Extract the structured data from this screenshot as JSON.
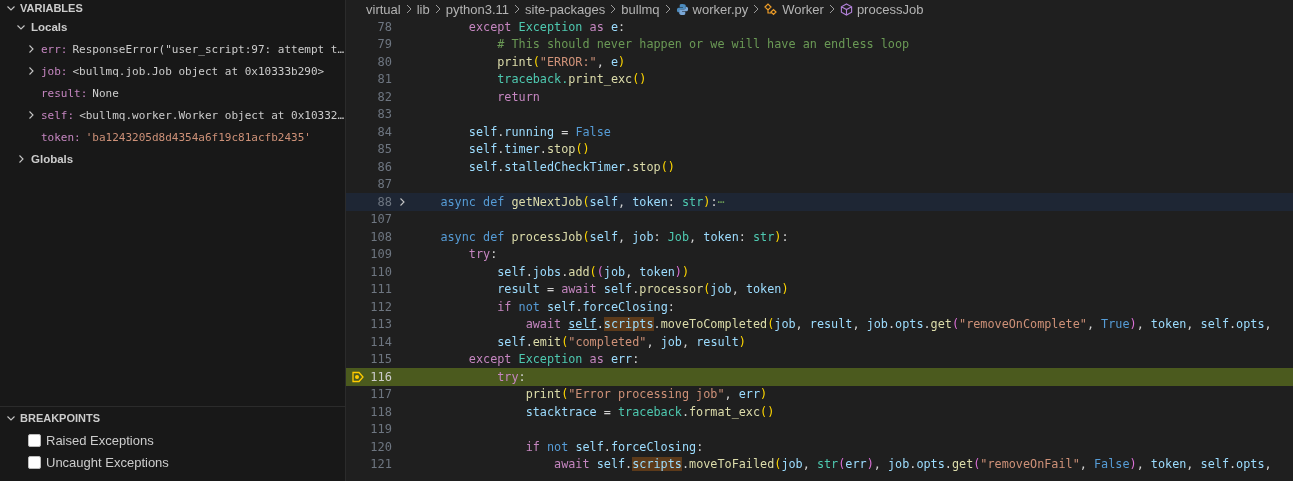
{
  "variables": {
    "title": "VARIABLES",
    "expanded": true,
    "scopes": [
      {
        "label": "Locals",
        "expanded": true,
        "items": [
          {
            "name": "err:",
            "value": "ResponseError(\"user_script:97: attempt t…",
            "kind": "object",
            "expandable": true
          },
          {
            "name": "job:",
            "value": "<bullmq.job.Job object at 0x10333b290>",
            "kind": "object",
            "expandable": true
          },
          {
            "name": "result:",
            "value": "None",
            "kind": "none",
            "expandable": false
          },
          {
            "name": "self:",
            "value": "<bullmq.worker.Worker object at 0x10332…",
            "kind": "object",
            "expandable": true
          },
          {
            "name": "token:",
            "value": "'ba1243205d8d4354a6f19c81acfb2435'",
            "kind": "string",
            "expandable": false
          }
        ]
      },
      {
        "label": "Globals",
        "expanded": false
      }
    ]
  },
  "breakpoints": {
    "title": "BREAKPOINTS",
    "expanded": true,
    "items": [
      {
        "label": "Raised Exceptions",
        "checked": false
      },
      {
        "label": "Uncaught Exceptions",
        "checked": false
      }
    ]
  },
  "breadcrumb": [
    {
      "label": "virtual",
      "kind": "folder"
    },
    {
      "label": "lib",
      "kind": "folder"
    },
    {
      "label": "python3.11",
      "kind": "folder"
    },
    {
      "label": "site-packages",
      "kind": "folder"
    },
    {
      "label": "bullmq",
      "kind": "folder"
    },
    {
      "label": "worker.py",
      "kind": "file"
    },
    {
      "label": "Worker",
      "kind": "class"
    },
    {
      "label": "processJob",
      "kind": "method"
    }
  ],
  "lines": [
    {
      "number": "78",
      "current": false,
      "folded": false,
      "tokens": [
        {
          "text": "        except ",
          "kind": "kw"
        },
        {
          "text": "Exception ",
          "kind": "cls"
        },
        {
          "text": "as ",
          "kind": "kw"
        },
        {
          "text": "e",
          "kind": "var"
        },
        {
          "text": ":",
          "kind": "p"
        }
      ]
    },
    {
      "number": "79",
      "current": false,
      "folded": false,
      "tokens": [
        {
          "text": "            # This should never happen or we will have an endless loop",
          "kind": "cm"
        }
      ]
    },
    {
      "number": "80",
      "current": false,
      "folded": false,
      "tokens": [
        {
          "text": "            print",
          "kind": "fn"
        },
        {
          "text": "(",
          "kind": "b1"
        },
        {
          "text": "\"ERROR:\"",
          "kind": "str"
        },
        {
          "text": ", ",
          "kind": "p"
        },
        {
          "text": "e",
          "kind": "var"
        },
        {
          "text": ")",
          "kind": "b1"
        }
      ]
    },
    {
      "number": "81",
      "current": false,
      "folded": false,
      "tokens": [
        {
          "text": "            traceback.",
          "kind": "cls"
        },
        {
          "text": "print_exc",
          "kind": "fn"
        },
        {
          "text": "()",
          "kind": "b1"
        }
      ]
    },
    {
      "number": "82",
      "current": false,
      "folded": false,
      "tokens": [
        {
          "text": "            return",
          "kind": "kw"
        }
      ]
    },
    {
      "number": "83",
      "current": false,
      "folded": false
    },
    {
      "number": "84",
      "current": false,
      "folded": false,
      "tokens": [
        {
          "text": "        self",
          "kind": "var"
        },
        {
          "text": ".",
          "kind": "p"
        },
        {
          "text": "running",
          "kind": "var"
        },
        {
          "text": " = ",
          "kind": "p"
        },
        {
          "text": "False",
          "kind": "st"
        }
      ]
    },
    {
      "number": "85",
      "current": false,
      "folded": false,
      "tokens": [
        {
          "text": "        self",
          "kind": "var"
        },
        {
          "text": ".",
          "kind": "p"
        },
        {
          "text": "timer",
          "kind": "var"
        },
        {
          "text": ".",
          "kind": "p"
        },
        {
          "text": "stop",
          "kind": "fn"
        },
        {
          "text": "()",
          "kind": "b1"
        }
      ]
    },
    {
      "number": "86",
      "current": false,
      "folded": false,
      "tokens": [
        {
          "text": "        self",
          "kind": "var"
        },
        {
          "text": ".",
          "kind": "p"
        },
        {
          "text": "stalledCheckTimer",
          "kind": "var"
        },
        {
          "text": ".",
          "kind": "p"
        },
        {
          "text": "stop",
          "kind": "fn"
        },
        {
          "text": "()",
          "kind": "b1"
        }
      ]
    },
    {
      "number": "87",
      "current": false,
      "folded": false
    },
    {
      "number": "88",
      "current": false,
      "folded": true,
      "tokens": [
        {
          "text": "    async def ",
          "kind": "st"
        },
        {
          "text": "getNextJob",
          "kind": "fn"
        },
        {
          "text": "(",
          "kind": "b1"
        },
        {
          "text": "self",
          "kind": "var"
        },
        {
          "text": ", ",
          "kind": "p"
        },
        {
          "text": "token",
          "kind": "var"
        },
        {
          "text": ": ",
          "kind": "p"
        },
        {
          "text": "str",
          "kind": "cls"
        },
        {
          "text": ")",
          "kind": "b1"
        },
        {
          "text": ":",
          "kind": "p"
        },
        {
          "text": "⋯",
          "kind": "cm"
        }
      ]
    },
    {
      "number": "107",
      "current": false,
      "folded": false
    },
    {
      "number": "108",
      "current": false,
      "folded": false,
      "tokens": [
        {
          "text": "    async def ",
          "kind": "st"
        },
        {
          "text": "processJob",
          "kind": "fn"
        },
        {
          "text": "(",
          "kind": "b1"
        },
        {
          "text": "self",
          "kind": "var"
        },
        {
          "text": ", ",
          "kind": "p"
        },
        {
          "text": "job",
          "kind": "var"
        },
        {
          "text": ": ",
          "kind": "p"
        },
        {
          "text": "Job",
          "kind": "cls"
        },
        {
          "text": ", ",
          "kind": "p"
        },
        {
          "text": "token",
          "kind": "var"
        },
        {
          "text": ": ",
          "kind": "p"
        },
        {
          "text": "str",
          "kind": "cls"
        },
        {
          "text": ")",
          "kind": "b1"
        },
        {
          "text": ":",
          "kind": "p"
        }
      ]
    },
    {
      "number": "109",
      "current": false,
      "folded": false,
      "tokens": [
        {
          "text": "        try",
          "kind": "kw"
        },
        {
          "text": ":",
          "kind": "p"
        }
      ]
    },
    {
      "number": "110",
      "current": false,
      "folded": false,
      "tokens": [
        {
          "text": "            self",
          "kind": "var"
        },
        {
          "text": ".",
          "kind": "p"
        },
        {
          "text": "jobs",
          "kind": "var"
        },
        {
          "text": ".",
          "kind": "p"
        },
        {
          "text": "add",
          "kind": "fn"
        },
        {
          "text": "(",
          "kind": "b1"
        },
        {
          "text": "(",
          "kind": "b2"
        },
        {
          "text": "job",
          "kind": "var"
        },
        {
          "text": ", ",
          "kind": "p"
        },
        {
          "text": "token",
          "kind": "var"
        },
        {
          "text": ")",
          "kind": "b2"
        },
        {
          "text": ")",
          "kind": "b1"
        }
      ]
    },
    {
      "number": "111",
      "current": false,
      "folded": false,
      "tokens": [
        {
          "text": "            result",
          "kind": "var"
        },
        {
          "text": " = ",
          "kind": "p"
        },
        {
          "text": "await ",
          "kind": "kw"
        },
        {
          "text": "self",
          "kind": "var"
        },
        {
          "text": ".",
          "kind": "p"
        },
        {
          "text": "processor",
          "kind": "fn"
        },
        {
          "text": "(",
          "kind": "b1"
        },
        {
          "text": "job",
          "kind": "var"
        },
        {
          "text": ", ",
          "kind": "p"
        },
        {
          "text": "token",
          "kind": "var"
        },
        {
          "text": ")",
          "kind": "b1"
        }
      ]
    },
    {
      "number": "112",
      "current": false,
      "folded": false,
      "tokens": [
        {
          "text": "            if ",
          "kind": "kw"
        },
        {
          "text": "not ",
          "kind": "st"
        },
        {
          "text": "self",
          "kind": "var"
        },
        {
          "text": ".",
          "kind": "p"
        },
        {
          "text": "forceClosing",
          "kind": "var"
        },
        {
          "text": ":",
          "kind": "p"
        }
      ]
    },
    {
      "number": "113",
      "current": false,
      "folded": false,
      "tokens": [
        {
          "text": "                await ",
          "kind": "kw"
        },
        {
          "text": "self",
          "kind": "link"
        },
        {
          "text": ".",
          "kind": "p"
        },
        {
          "text": "scripts",
          "kind": "mark"
        },
        {
          "text": ".",
          "kind": "p"
        },
        {
          "text": "moveToCompleted",
          "kind": "fn"
        },
        {
          "text": "(",
          "kind": "b1"
        },
        {
          "text": "job",
          "kind": "var"
        },
        {
          "text": ", ",
          "kind": "p"
        },
        {
          "text": "result",
          "kind": "var"
        },
        {
          "text": ", ",
          "kind": "p"
        },
        {
          "text": "job",
          "kind": "var"
        },
        {
          "text": ".",
          "kind": "p"
        },
        {
          "text": "opts",
          "kind": "var"
        },
        {
          "text": ".",
          "kind": "p"
        },
        {
          "text": "get",
          "kind": "fn"
        },
        {
          "text": "(",
          "kind": "b2"
        },
        {
          "text": "\"removeOnComplete\"",
          "kind": "str"
        },
        {
          "text": ", ",
          "kind": "p"
        },
        {
          "text": "True",
          "kind": "st"
        },
        {
          "text": ")",
          "kind": "b2"
        },
        {
          "text": ", ",
          "kind": "p"
        },
        {
          "text": "token",
          "kind": "var"
        },
        {
          "text": ", ",
          "kind": "p"
        },
        {
          "text": "self",
          "kind": "var"
        },
        {
          "text": ".",
          "kind": "p"
        },
        {
          "text": "opts",
          "kind": "var"
        },
        {
          "text": ",",
          "kind": "p"
        }
      ]
    },
    {
      "number": "114",
      "current": false,
      "folded": false,
      "tokens": [
        {
          "text": "            self",
          "kind": "var"
        },
        {
          "text": ".",
          "kind": "p"
        },
        {
          "text": "emit",
          "kind": "fn"
        },
        {
          "text": "(",
          "kind": "b1"
        },
        {
          "text": "\"completed\"",
          "kind": "str"
        },
        {
          "text": ", ",
          "kind": "p"
        },
        {
          "text": "job",
          "kind": "var"
        },
        {
          "text": ", ",
          "kind": "p"
        },
        {
          "text": "result",
          "kind": "var"
        },
        {
          "text": ")",
          "kind": "b1"
        }
      ]
    },
    {
      "number": "115",
      "current": false,
      "folded": false,
      "tokens": [
        {
          "text": "        except ",
          "kind": "kw"
        },
        {
          "text": "Exception ",
          "kind": "cls"
        },
        {
          "text": "as ",
          "kind": "kw"
        },
        {
          "text": "err",
          "kind": "var"
        },
        {
          "text": ":",
          "kind": "p"
        }
      ]
    },
    {
      "number": "116",
      "current": true,
      "folded": false,
      "tokens": [
        {
          "text": "            try",
          "kind": "kw"
        },
        {
          "text": ":",
          "kind": "p"
        }
      ]
    },
    {
      "number": "117",
      "current": false,
      "folded": false,
      "tokens": [
        {
          "text": "                print",
          "kind": "fn"
        },
        {
          "text": "(",
          "kind": "b1"
        },
        {
          "text": "\"Error processing job\"",
          "kind": "str"
        },
        {
          "text": ", ",
          "kind": "p"
        },
        {
          "text": "err",
          "kind": "var"
        },
        {
          "text": ")",
          "kind": "b1"
        }
      ]
    },
    {
      "number": "118",
      "current": false,
      "folded": false,
      "tokens": [
        {
          "text": "                stacktrace",
          "kind": "var"
        },
        {
          "text": " = ",
          "kind": "p"
        },
        {
          "text": "traceback",
          "kind": "cls"
        },
        {
          "text": ".",
          "kind": "p"
        },
        {
          "text": "format_exc",
          "kind": "fn"
        },
        {
          "text": "()",
          "kind": "b1"
        }
      ]
    },
    {
      "number": "119",
      "current": false,
      "folded": false
    },
    {
      "number": "120",
      "current": false,
      "folded": false,
      "tokens": [
        {
          "text": "                if ",
          "kind": "kw"
        },
        {
          "text": "not ",
          "kind": "st"
        },
        {
          "text": "self",
          "kind": "var"
        },
        {
          "text": ".",
          "kind": "p"
        },
        {
          "text": "forceClosing",
          "kind": "var"
        },
        {
          "text": ":",
          "kind": "p"
        }
      ]
    },
    {
      "number": "121",
      "current": false,
      "folded": false,
      "tokens": [
        {
          "text": "                    await ",
          "kind": "kw"
        },
        {
          "text": "self",
          "kind": "var"
        },
        {
          "text": ".",
          "kind": "p"
        },
        {
          "text": "scripts",
          "kind": "mark"
        },
        {
          "text": ".",
          "kind": "p"
        },
        {
          "text": "moveToFailed",
          "kind": "fn"
        },
        {
          "text": "(",
          "kind": "b1"
        },
        {
          "text": "job",
          "kind": "var"
        },
        {
          "text": ", ",
          "kind": "p"
        },
        {
          "text": "str",
          "kind": "cls"
        },
        {
          "text": "(",
          "kind": "b2"
        },
        {
          "text": "err",
          "kind": "var"
        },
        {
          "text": ")",
          "kind": "b2"
        },
        {
          "text": ", ",
          "kind": "p"
        },
        {
          "text": "job",
          "kind": "var"
        },
        {
          "text": ".",
          "kind": "p"
        },
        {
          "text": "opts",
          "kind": "var"
        },
        {
          "text": ".",
          "kind": "p"
        },
        {
          "text": "get",
          "kind": "fn"
        },
        {
          "text": "(",
          "kind": "b2"
        },
        {
          "text": "\"removeOnFail\"",
          "kind": "str"
        },
        {
          "text": ", ",
          "kind": "p"
        },
        {
          "text": "False",
          "kind": "st"
        },
        {
          "text": ")",
          "kind": "b2"
        },
        {
          "text": ", ",
          "kind": "p"
        },
        {
          "text": "token",
          "kind": "var"
        },
        {
          "text": ", ",
          "kind": "p"
        },
        {
          "text": "self",
          "kind": "var"
        },
        {
          "text": ".",
          "kind": "p"
        },
        {
          "text": "opts",
          "kind": "var"
        },
        {
          "text": ",",
          "kind": "p"
        }
      ]
    }
  ]
}
